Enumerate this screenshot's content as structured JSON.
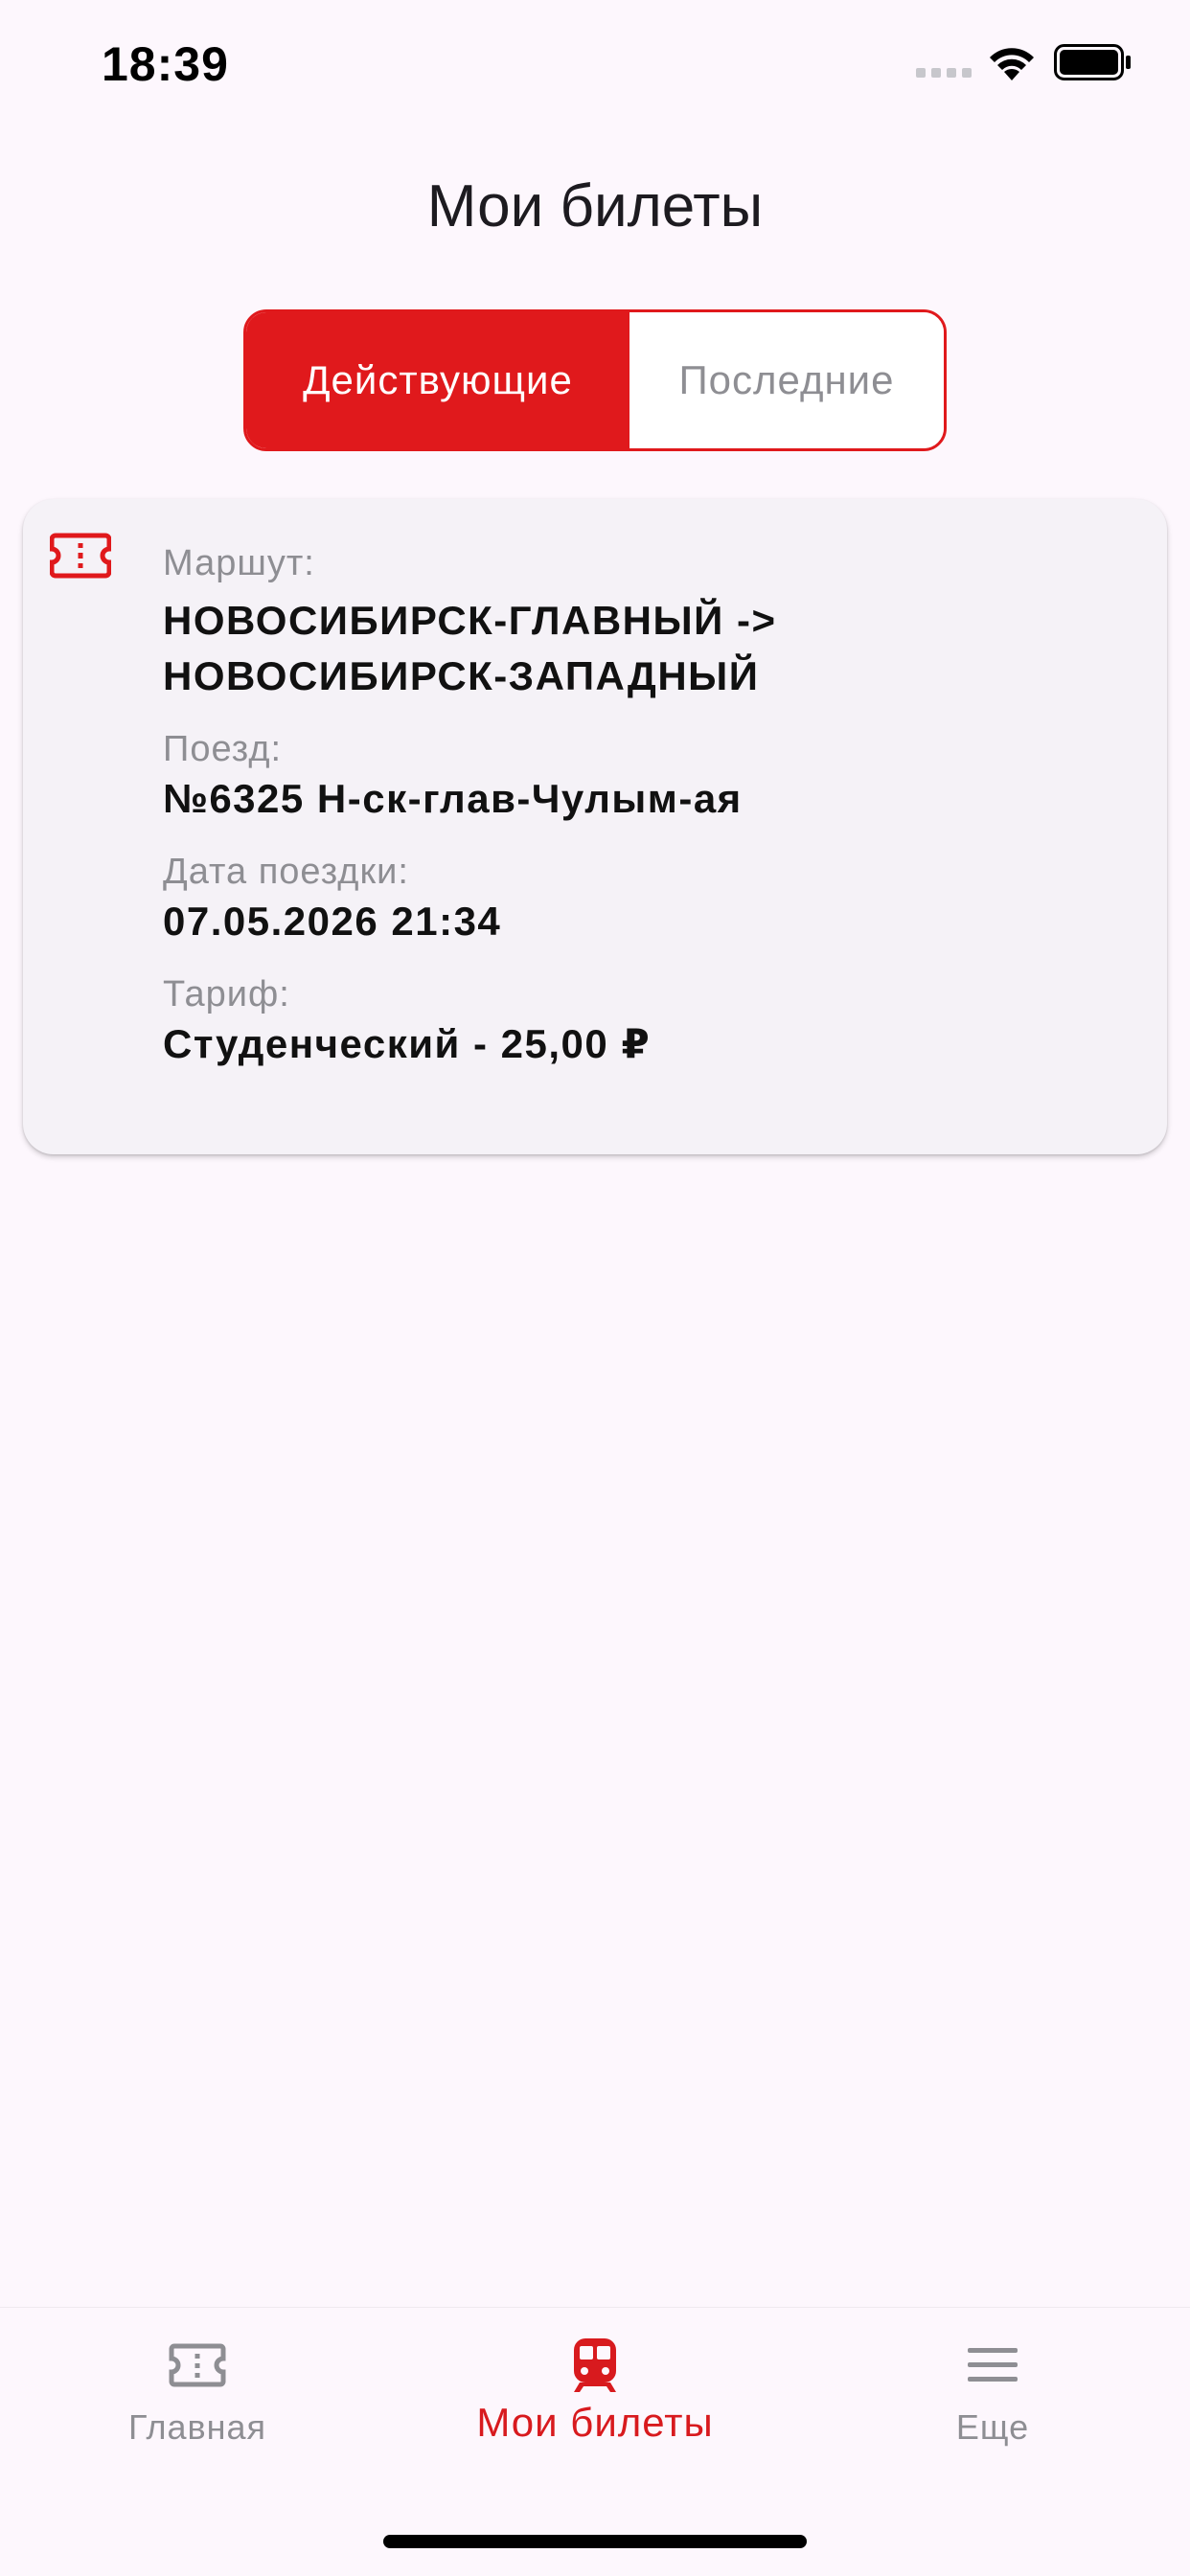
{
  "status_bar": {
    "time": "18:39",
    "signal_icon": "cellular-signal-icon",
    "wifi_icon": "wifi-icon",
    "battery_icon": "battery-icon"
  },
  "header": {
    "title": "Мои билеты"
  },
  "tabs": {
    "active_label": "Действующие",
    "inactive_label": "Последние",
    "accent_color": "#e0191c"
  },
  "ticket": {
    "icon": "ticket-icon",
    "route_label": "Маршут:",
    "route_value": "НОВОСИБИРСК-ГЛАВНЫЙ  ->\nНОВОСИБИРСК-ЗАПАДНЫЙ",
    "train_label": "Поезд:",
    "train_value": "№6325 Н-ск-глав-Чулым-ая",
    "date_label": "Дата поездки:",
    "date_value": "07.05.2026 21:34",
    "tariff_label": "Тариф:",
    "tariff_value": "Студенческий - 25,00 ₽"
  },
  "bottom_nav": {
    "home_label": "Главная",
    "tickets_label": "Мои билеты",
    "more_label": "Еще",
    "active_color": "#d81a1e",
    "inactive_color": "#8e8e93"
  }
}
